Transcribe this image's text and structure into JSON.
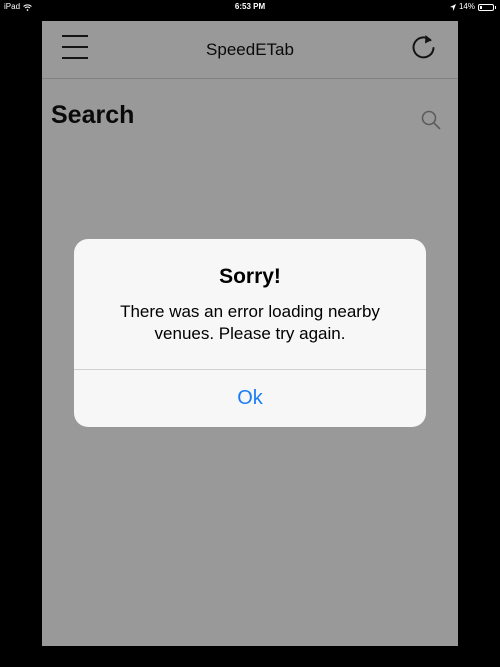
{
  "status_bar": {
    "device": "iPad",
    "time": "6:53 PM",
    "battery": "14%",
    "battery_level": 0.14
  },
  "navbar": {
    "title": "SpeedETab"
  },
  "page": {
    "title": "Search"
  },
  "alert": {
    "title": "Sorry!",
    "message": "There was an error loading nearby venues. Please try again.",
    "button_label": "Ok"
  },
  "colors": {
    "accent": "#1a7cf5",
    "overlay": "rgba(0,0,0,0.40)"
  }
}
